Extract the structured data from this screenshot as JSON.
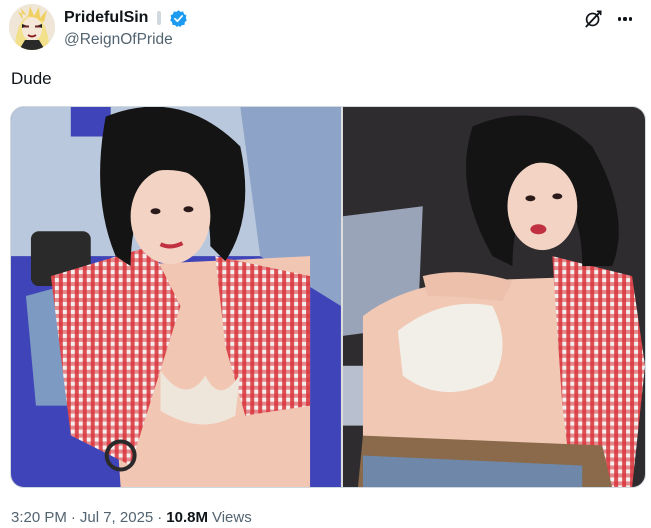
{
  "author": {
    "display_name": "PridefulSin",
    "handle": "@ReignOfPride",
    "verified": true,
    "verified_color": "#1d9bf0",
    "avatar_icon": "comic-character-avatar"
  },
  "header_actions": {
    "grok_icon": "grok-icon",
    "more_icon": "more-horizontal-icon"
  },
  "tweet": {
    "text": "Dude"
  },
  "media": {
    "photos": [
      {
        "icon": "photo-left"
      },
      {
        "icon": "photo-right"
      }
    ]
  },
  "meta": {
    "time": "3:20 PM",
    "separator": "·",
    "date": "Jul 7, 2025",
    "separator2": "·",
    "views_count": "10.8M",
    "views_label": "Views"
  },
  "colors": {
    "text_primary": "#0f1419",
    "text_secondary": "#536471",
    "border": "#cfd9de"
  }
}
